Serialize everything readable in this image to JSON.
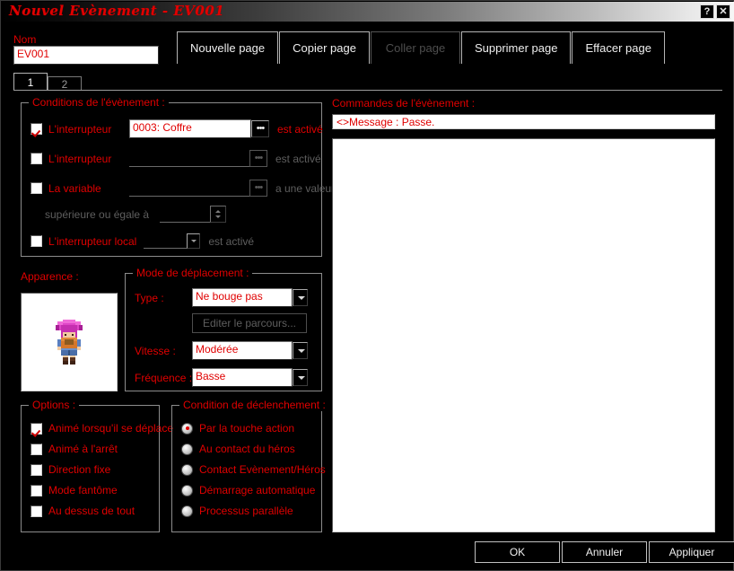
{
  "window": {
    "title": "Nouvel Evènement - EV001",
    "help_button": "?",
    "close_button": "✕"
  },
  "toolbar": {
    "buttons": [
      {
        "label": "Nouvelle page",
        "enabled": true
      },
      {
        "label": "Copier page",
        "enabled": true
      },
      {
        "label": "Coller page",
        "enabled": false
      },
      {
        "label": "Supprimer page",
        "enabled": true
      },
      {
        "label": "Effacer page",
        "enabled": true
      }
    ]
  },
  "name_field": {
    "label": "Nom",
    "value": "EV001"
  },
  "page_tabs": [
    {
      "label": "1",
      "active": true
    },
    {
      "label": "2",
      "active": false
    }
  ],
  "conditions": {
    "title": "Conditions de l'évènement :",
    "rows": [
      {
        "label": "L'interrupteur",
        "checked": true,
        "value": "0003: Coffre",
        "browse": "•••",
        "suffix": "est activé"
      },
      {
        "label": "L'interrupteur",
        "checked": false,
        "value": "",
        "browse": "•••",
        "suffix": "est activé"
      },
      {
        "label": "La variable",
        "checked": false,
        "value": "",
        "browse": "•••",
        "suffix": "a une valeur"
      }
    ],
    "variable_operator": "supérieure ou égale à",
    "variable_value": "",
    "local_switch": {
      "label": "L'interrupteur local",
      "checked": false,
      "value": "",
      "suffix": "est activé"
    }
  },
  "appearance": {
    "title": "Apparence :",
    "sprite_name": "character-sprite"
  },
  "movement": {
    "title": "Mode de déplacement :",
    "type_label": "Type :",
    "type_value": "Ne bouge pas",
    "route_button": "Editer le parcours...",
    "route_enabled": false,
    "speed_label": "Vitesse :",
    "speed_value": "Modérée",
    "frequency_label": "Fréquence :",
    "frequency_value": "Basse"
  },
  "options": {
    "title": "Options :",
    "items": [
      {
        "label": "Animé lorsqu'il se déplace",
        "checked": true
      },
      {
        "label": "Animé à l'arrêt",
        "checked": false
      },
      {
        "label": "Direction fixe",
        "checked": false
      },
      {
        "label": "Mode fantôme",
        "checked": false
      },
      {
        "label": "Au dessus de tout",
        "checked": false
      }
    ]
  },
  "trigger": {
    "title": "Condition de déclenchement :",
    "items": [
      {
        "label": "Par la touche action",
        "selected": true
      },
      {
        "label": "Au contact du héros",
        "selected": false
      },
      {
        "label": "Contact Evènement/Héros",
        "selected": false
      },
      {
        "label": "Démarrage automatique",
        "selected": false
      },
      {
        "label": "Processus parallèle",
        "selected": false
      }
    ]
  },
  "commands": {
    "title": "Commandes de l'évènement :",
    "lines": [
      "<>Message : Passe."
    ]
  },
  "footer": {
    "ok": "OK",
    "cancel": "Annuler",
    "apply": "Appliquer"
  },
  "colors": {
    "accent_red": "#e00000",
    "background": "#000000",
    "field_background": "#ffffff",
    "border": "#8c8c8c",
    "disabled_text": "#5e5e5e"
  }
}
